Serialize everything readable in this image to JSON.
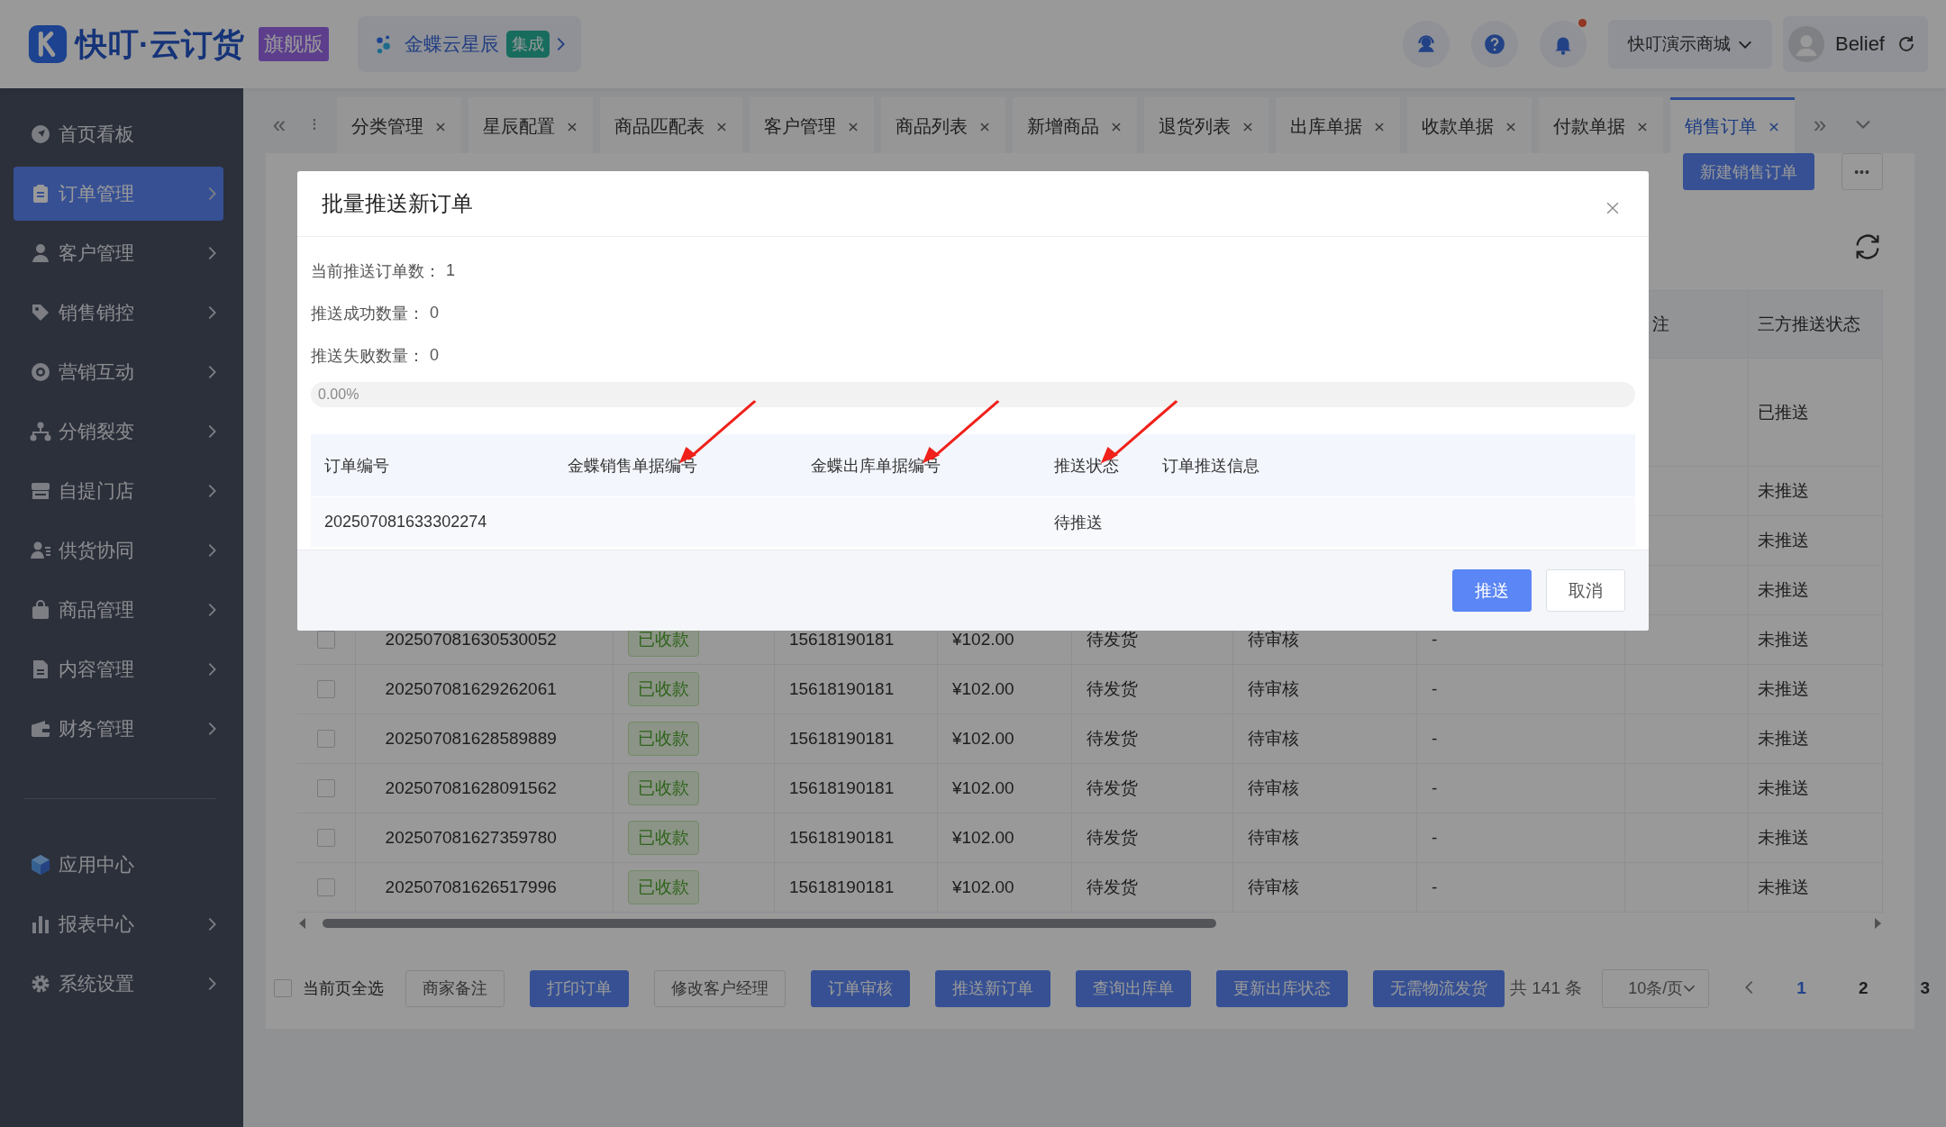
{
  "header": {
    "logo_text": "快叮·云订货",
    "edition_badge": "旗舰版",
    "integration": {
      "name": "金蝶云星辰",
      "badge": "集成"
    },
    "has_unread": true,
    "store_selector": "快叮演示商城",
    "user": "Belief"
  },
  "sidebar": {
    "items": [
      {
        "label": "首页看板",
        "selected": false,
        "expandable": false
      },
      {
        "label": "订单管理",
        "selected": true,
        "expandable": true
      },
      {
        "label": "客户管理",
        "selected": false,
        "expandable": true
      },
      {
        "label": "销售销控",
        "selected": false,
        "expandable": true
      },
      {
        "label": "营销互动",
        "selected": false,
        "expandable": true
      },
      {
        "label": "分销裂变",
        "selected": false,
        "expandable": true
      },
      {
        "label": "自提门店",
        "selected": false,
        "expandable": true
      },
      {
        "label": "供货协同",
        "selected": false,
        "expandable": true
      },
      {
        "label": "商品管理",
        "selected": false,
        "expandable": true
      },
      {
        "label": "内容管理",
        "selected": false,
        "expandable": true
      },
      {
        "label": "财务管理",
        "selected": false,
        "expandable": true
      }
    ],
    "bottom_items": [
      {
        "label": "应用中心",
        "selected": false,
        "expandable": false
      },
      {
        "label": "报表中心",
        "selected": false,
        "expandable": true
      },
      {
        "label": "系统设置",
        "selected": false,
        "expandable": true
      }
    ]
  },
  "tabs": {
    "prev": "«",
    "more": "⁝",
    "next": "»",
    "items": [
      {
        "label": "分类管理",
        "selected": false
      },
      {
        "label": "星辰配置",
        "selected": false
      },
      {
        "label": "商品匹配表",
        "selected": false
      },
      {
        "label": "客户管理",
        "selected": false
      },
      {
        "label": "商品列表",
        "selected": false
      },
      {
        "label": "新增商品",
        "selected": false
      },
      {
        "label": "退货列表",
        "selected": false
      },
      {
        "label": "出库单据",
        "selected": false
      },
      {
        "label": "收款单据",
        "selected": false
      },
      {
        "label": "付款单据",
        "selected": false
      },
      {
        "label": "销售订单",
        "selected": true
      }
    ]
  },
  "page": {
    "new_button": "新建销售订单",
    "more_button": "•••"
  },
  "table": {
    "header": {
      "column_9": "注",
      "push_status": "三方推送状态"
    },
    "rows": [
      {
        "push_status": "已推送"
      },
      {
        "push_status": "未推送"
      },
      {
        "push_status": "未推送"
      },
      {
        "push_status": "未推送"
      },
      {
        "checked": false,
        "order_no": "202507081630530052",
        "payment": "已收款",
        "phone": "15618190181",
        "amount": "¥102.00",
        "shipping": "待发货",
        "audit": "待审核",
        "remark": "-",
        "push_status": "未推送"
      },
      {
        "checked": false,
        "order_no": "202507081629262061",
        "payment": "已收款",
        "phone": "15618190181",
        "amount": "¥102.00",
        "shipping": "待发货",
        "audit": "待审核",
        "remark": "-",
        "push_status": "未推送"
      },
      {
        "checked": false,
        "order_no": "202507081628589889",
        "payment": "已收款",
        "phone": "15618190181",
        "amount": "¥102.00",
        "shipping": "待发货",
        "audit": "待审核",
        "remark": "-",
        "push_status": "未推送"
      },
      {
        "checked": false,
        "order_no": "202507081628091562",
        "payment": "已收款",
        "phone": "15618190181",
        "amount": "¥102.00",
        "shipping": "待发货",
        "audit": "待审核",
        "remark": "-",
        "push_status": "未推送"
      },
      {
        "checked": false,
        "order_no": "202507081627359780",
        "payment": "已收款",
        "phone": "15618190181",
        "amount": "¥102.00",
        "shipping": "待发货",
        "audit": "待审核",
        "remark": "-",
        "push_status": "未推送"
      },
      {
        "checked": false,
        "order_no": "202507081626517996",
        "payment": "已收款",
        "phone": "15618190181",
        "amount": "¥102.00",
        "shipping": "待发货",
        "audit": "待审核",
        "remark": "-",
        "push_status": "未推送"
      }
    ]
  },
  "bulk_bar": {
    "select_all": {
      "label": "当前页全选",
      "checked": false
    },
    "buttons": [
      {
        "label": "商家备注",
        "kind": "default"
      },
      {
        "label": "打印订单",
        "kind": "primary"
      },
      {
        "label": "修改客户经理",
        "kind": "default"
      },
      {
        "label": "订单审核",
        "kind": "primary"
      },
      {
        "label": "推送新订单",
        "kind": "primary"
      },
      {
        "label": "查询出库单",
        "kind": "primary"
      },
      {
        "label": "更新出库状态",
        "kind": "primary"
      },
      {
        "label": "无需物流发货",
        "kind": "primary"
      }
    ],
    "total": "共 141 条",
    "page_size": "10条/页",
    "pages": [
      {
        "label": "1",
        "selected": true
      },
      {
        "label": "2",
        "selected": false
      },
      {
        "label": "3",
        "selected": false
      }
    ]
  },
  "modal": {
    "title": "批量推送新订单",
    "stats": [
      {
        "label": "当前推送订单数：",
        "value": "1"
      },
      {
        "label": "推送成功数量：",
        "value": "0"
      },
      {
        "label": "推送失败数量：",
        "value": "0"
      }
    ],
    "progress": {
      "level": 0,
      "label": "0.00%"
    },
    "columns": [
      {
        "label": "订单编号",
        "marked": false
      },
      {
        "label": "金蝶销售单据编号",
        "marked": true
      },
      {
        "label": "金蝶出库单据编号",
        "marked": true
      },
      {
        "label": "推送状态",
        "marked": true
      },
      {
        "label": "订单推送信息",
        "marked": false
      }
    ],
    "rows": [
      {
        "order_no": "202507081633302274",
        "push_status": "待推送"
      }
    ],
    "buttons": [
      {
        "label": "推送",
        "kind": "primary"
      },
      {
        "label": "取消",
        "kind": "default"
      }
    ]
  }
}
